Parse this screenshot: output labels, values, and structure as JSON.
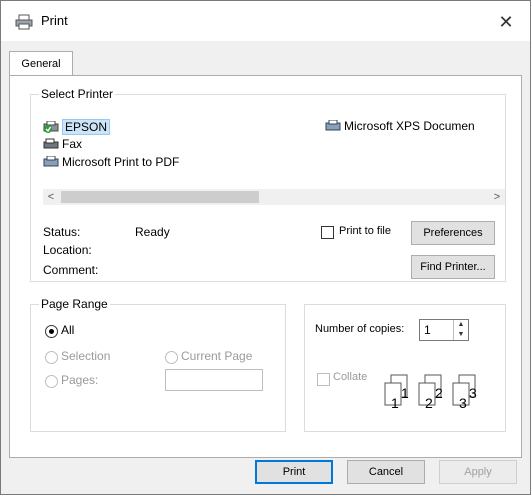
{
  "window": {
    "title": "Print",
    "close_glyph": "✕"
  },
  "tabs": [
    {
      "label": "General"
    }
  ],
  "select_printer": {
    "group_label": "Select Printer",
    "printers": [
      {
        "name": "EPSON",
        "icon": "printer-default-icon",
        "selected": true
      },
      {
        "name": "Fax",
        "icon": "fax-icon",
        "selected": false
      },
      {
        "name": "Microsoft Print to PDF",
        "icon": "printer-icon",
        "selected": false
      },
      {
        "name": "Microsoft XPS Documen",
        "icon": "printer-icon",
        "selected": false
      }
    ],
    "scroll_left": "<",
    "scroll_right": ">",
    "status_label": "Status:",
    "status_value": "Ready",
    "location_label": "Location:",
    "comment_label": "Comment:",
    "print_to_file_label": "Print to file",
    "preferences_label": "Preferences",
    "find_printer_label": "Find Printer..."
  },
  "page_range": {
    "group_label": "Page Range",
    "all_label": "All",
    "selection_label": "Selection",
    "current_page_label": "Current Page",
    "pages_label": "Pages:",
    "selected": "All"
  },
  "copies": {
    "number_label": "Number of copies:",
    "value": "1",
    "collate_label": "Collate",
    "collate_pages": [
      "1",
      "1",
      "2",
      "2",
      "3",
      "3"
    ]
  },
  "footer": {
    "print_label": "Print",
    "cancel_label": "Cancel",
    "apply_label": "Apply"
  },
  "colors": {
    "selection": "#cce4f7",
    "accent": "#0078d7"
  }
}
